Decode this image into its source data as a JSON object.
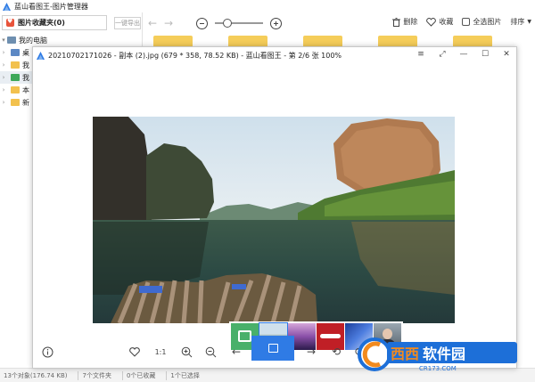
{
  "app": {
    "title": "蓝山看图王-图片管理器",
    "accent_color": "#2f7be5"
  },
  "left_panel": {
    "favorites_label": "图片收藏夹(0)",
    "export_label": "一键导出",
    "tree": [
      {
        "label": "我的电脑",
        "icon": "computer-icon",
        "expanded": true
      },
      {
        "label": "桌",
        "icon": "document-folder-icon"
      },
      {
        "label": "我",
        "icon": "folder-icon"
      },
      {
        "label": "我",
        "icon": "green-folder-icon",
        "selected": true
      },
      {
        "label": "本",
        "icon": "folder-icon"
      },
      {
        "label": "新",
        "icon": "folder-icon"
      }
    ]
  },
  "toolbar": {
    "zoom_level": 0.2,
    "delete_label": "删除",
    "favorite_label": "收藏",
    "select_all_label": "全选图片",
    "sort_label": "排序"
  },
  "statusbar": {
    "objects": "13个对象(176.74 KB)",
    "folders": "7个文件夹",
    "favorited": "0个已收藏",
    "selected": "1个已选择"
  },
  "viewer": {
    "title": "20210702171026 - 副本 (2).jpg (679 * 358, 78.52 KB) - 蓝山看图王 - 第 2/6 张 100%",
    "ratio_label": "1:1",
    "thumbnails": [
      "calendar-thumb",
      "landscape-thumb",
      "purple-sky-thumb",
      "cola-thumb",
      "blue-flower-thumb",
      "portrait-thumb"
    ],
    "active_thumbnail": 1
  },
  "watermark": {
    "text": "西西软件园",
    "url": "CR173.COM"
  }
}
